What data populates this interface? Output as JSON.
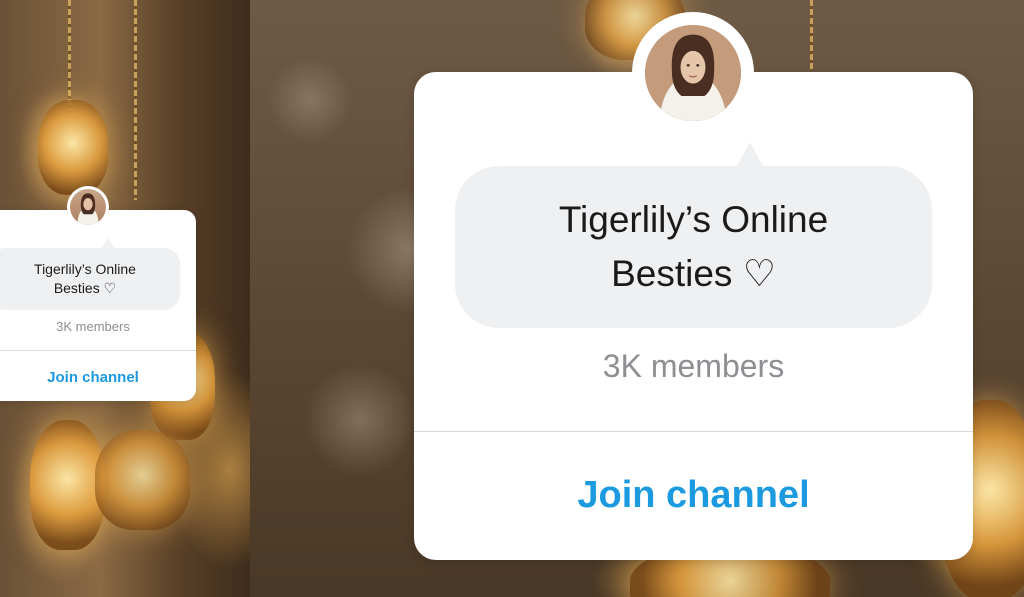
{
  "channel": {
    "name": "Tigerlily’s Online Besties ♡",
    "members": "3K members",
    "join_label": "Join channel"
  },
  "avatar_icon": "profile-photo",
  "colors": {
    "card_background": "#ffffff",
    "bubble_background": "#eff0f2",
    "members_text": "#8e8e93",
    "join_link": "#1b9ae0",
    "title_text": "#1a1a1a"
  }
}
